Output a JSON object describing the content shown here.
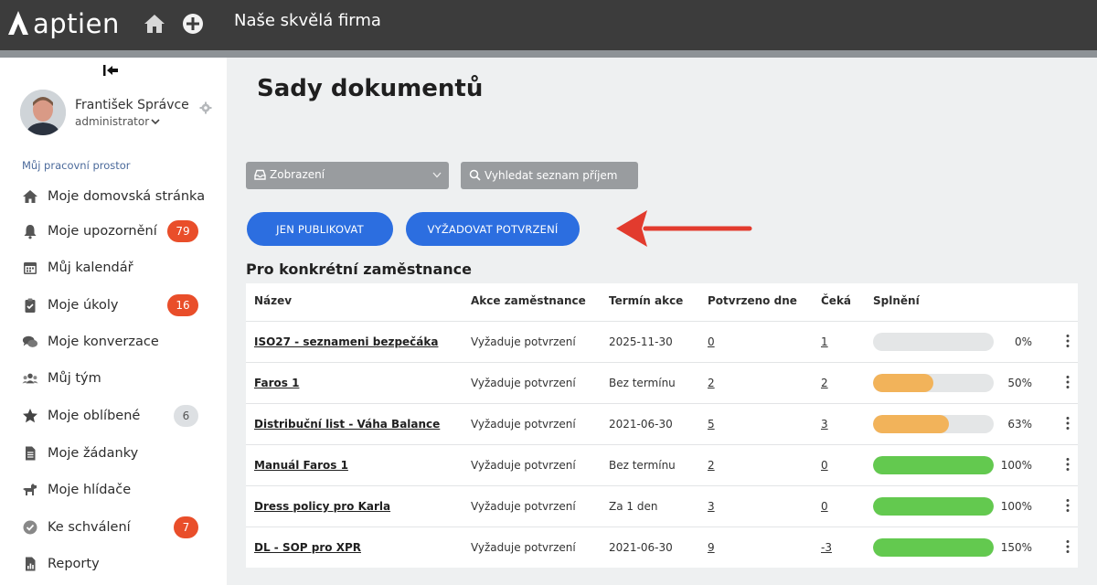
{
  "app": {
    "logo_text": "aptien",
    "company": "Naše skvělá firma"
  },
  "user": {
    "name": "František Správce",
    "role": "administrator"
  },
  "sidebar": {
    "section_label": "Můj pracovní prostor",
    "items": [
      {
        "label": "Moje domovská stránka",
        "icon": "home-icon",
        "badge": null
      },
      {
        "label": "Moje upozornění",
        "icon": "bell-icon",
        "badge": "79"
      },
      {
        "label": "Můj kalendář",
        "icon": "calendar-icon",
        "badge": null
      },
      {
        "label": "Moje úkoly",
        "icon": "clipboard-icon",
        "badge": "16"
      },
      {
        "label": "Moje konverzace",
        "icon": "chat-icon",
        "badge": null
      },
      {
        "label": "Můj tým",
        "icon": "team-icon",
        "badge": null
      },
      {
        "label": "Moje oblíbené",
        "icon": "star-icon",
        "badge": "6"
      },
      {
        "label": "Moje žádanky",
        "icon": "document-icon",
        "badge": null
      },
      {
        "label": "Moje hlídače",
        "icon": "dog-icon",
        "badge": null
      },
      {
        "label": "Ke schválení",
        "icon": "check-circle-icon",
        "badge": "7"
      },
      {
        "label": "Reporty",
        "icon": "report-icon",
        "badge": null
      }
    ]
  },
  "main": {
    "title": "Sady dokumentů",
    "view_dropdown": "Zobrazení",
    "search_placeholder": "Vyhledat seznam příjem",
    "buttons": {
      "publish": "JEN PUBLIKOVAT",
      "require": "VYŽADOVAT POTVRZENÍ"
    },
    "section_title": "Pro konkrétní zaměstnance",
    "table": {
      "columns": [
        "Název",
        "Akce zaměstnance",
        "Termín akce",
        "Potvrzeno dne",
        "Čeká",
        "Splnění"
      ],
      "rows": [
        {
          "name": "ISO27 - seznameni bezpečáka",
          "action": "Vyžaduje potvrzení",
          "deadline": "2025-11-30",
          "confirmed": "0",
          "waiting": "1",
          "progress": 0,
          "progress_label": "0%",
          "color": "#e4e6e7"
        },
        {
          "name": "Faros 1",
          "action": "Vyžaduje potvrzení",
          "deadline": "Bez termínu",
          "confirmed": "2",
          "waiting": "2",
          "progress": 50,
          "progress_label": "50%",
          "color": "#f2b35a"
        },
        {
          "name": "Distribuční list - Váha Balance",
          "action": "Vyžaduje potvrzení",
          "deadline": "2021-06-30",
          "confirmed": "5",
          "waiting": "3",
          "progress": 63,
          "progress_label": "63%",
          "color": "#f2b35a"
        },
        {
          "name": "Manuál Faros 1",
          "action": "Vyžaduje potvrzení",
          "deadline": "Bez termínu",
          "confirmed": "2",
          "waiting": "0",
          "progress": 100,
          "progress_label": "100%",
          "color": "#63c94f"
        },
        {
          "name": "Dress policy pro Karla",
          "action": "Vyžaduje potvrzení",
          "deadline": "Za 1 den",
          "confirmed": "3",
          "waiting": "0",
          "progress": 100,
          "progress_label": "100%",
          "color": "#63c94f"
        },
        {
          "name": "DL - SOP pro XPR",
          "action": "Vyžaduje potvrzení",
          "deadline": "2021-06-30",
          "confirmed": "9",
          "waiting": "-3",
          "progress": 150,
          "progress_label": "150%",
          "color": "#63c94f"
        }
      ]
    }
  },
  "colors": {
    "topbar": "#3c3c3c",
    "primary_button": "#2c6ee0",
    "badge": "#e94e2a",
    "annotation_arrow": "#e23b2e"
  }
}
